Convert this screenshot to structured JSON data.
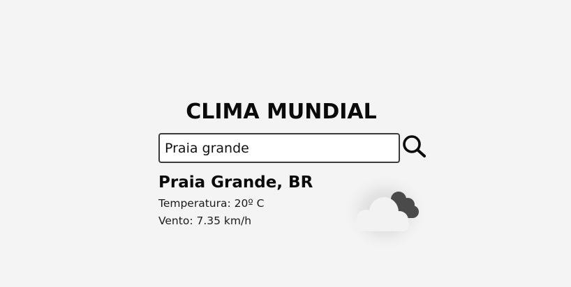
{
  "app": {
    "title": "CLIMA MUNDIAL"
  },
  "search": {
    "value": "Praia grande",
    "button_icon": "search-icon"
  },
  "weather": {
    "city": "Praia Grande, BR",
    "temperature_text": "Temperatura: 20º C",
    "wind_text": "Vento: 7.35 km/h",
    "condition_icon": "cloudy-icon"
  },
  "colors": {
    "background": "#f4f4f4",
    "text": "#0a0a0a",
    "input_border": "#3a3a3a",
    "cloud_front": "#f2f2f2",
    "cloud_back": "#4a4a4a"
  }
}
